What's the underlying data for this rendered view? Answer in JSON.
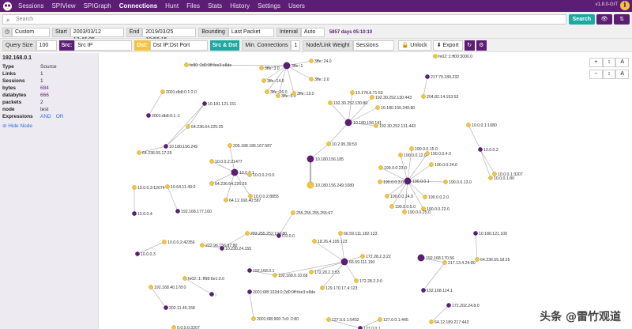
{
  "nav": {
    "items": [
      "Sessions",
      "SPIView",
      "SPIGraph",
      "Connections",
      "Hunt",
      "Files",
      "Stats",
      "History",
      "Settings",
      "Users"
    ],
    "active": "Connections",
    "version": "v1.8.0-GIT"
  },
  "search": {
    "placeholder": "Search",
    "button": "Search"
  },
  "time": {
    "range": "Custom",
    "start_label": "Start",
    "start_value": "2003/03/12 13:46:05",
    "end_label": "End",
    "end_value": "2019/03/25 18:56:15",
    "bounding_label": "Bounding",
    "bounding_value": "Last Packet",
    "interval_label": "Interval",
    "interval_value": "Auto",
    "days_text": "5857 days 05:10:10"
  },
  "options": {
    "query_size_label": "Query Size",
    "query_size_value": "100",
    "src_badge": "Src:",
    "src_value": "Src IP",
    "dst_badge": "Dst:",
    "dst_value": "Dst IP:Dst Port",
    "src_dst_button": "Src & Dst",
    "min_conn_label": "Min. Connections",
    "min_conn_value": "1",
    "weight_label": "Node/Link Weight",
    "weight_value": "Sessions",
    "unlock_button": "Unlock",
    "export_button": "Export"
  },
  "sidebar": {
    "title": "192.168.0.1",
    "rows": [
      {
        "key": "Type",
        "value": "Source"
      },
      {
        "key": "Links",
        "value": "1"
      },
      {
        "key": "Sessions",
        "value": "1"
      },
      {
        "key": "bytes",
        "value": "684"
      },
      {
        "key": "databytes",
        "value": "666"
      },
      {
        "key": "packets",
        "value": "2"
      },
      {
        "key": "node",
        "value": "test"
      }
    ],
    "expressions_label": "Expressions",
    "and_label": "AND",
    "or_label": "OR",
    "hide_node": "Hide Node"
  },
  "zoom": {
    "row1": [
      "+",
      "↕",
      "A"
    ],
    "row2": [
      "−",
      "↕",
      "A"
    ]
  },
  "colors": {
    "primary": "#5c1d74",
    "accent": "#f2c53a",
    "teal": "#1ba9a1"
  },
  "graph": {
    "nodes": [
      {
        "id": "n1",
        "label": "fe80::2d0:9ff:fee3:e8de",
        "type": "dst"
      },
      {
        "id": "n2",
        "label": "3ffe::1",
        "type": "src"
      },
      {
        "id": "n3",
        "label": "3ffe::3.0",
        "type": "dst"
      },
      {
        "id": "n4",
        "label": "3ffe::24.0",
        "type": "dst"
      },
      {
        "id": "n5",
        "label": "3ffe::14.0",
        "type": "dst"
      },
      {
        "id": "n6",
        "label": "3ffe::26.0",
        "type": "dst"
      },
      {
        "id": "n7",
        "label": "3ffe::5.0",
        "type": "dst"
      },
      {
        "id": "n8",
        "label": "3ffe::13.0",
        "type": "dst"
      },
      {
        "id": "n9",
        "label": "3ffe::2.0",
        "type": "dst"
      },
      {
        "id": "n10",
        "label": "fe02::1:ff00:3000.0",
        "type": "dst"
      },
      {
        "id": "n11",
        "label": "217.70.180.232",
        "type": "src"
      },
      {
        "id": "n12",
        "label": "204.82.14.153:53",
        "type": "dst"
      },
      {
        "id": "n13",
        "label": "2001:db8:0:1:2.0",
        "type": "dst"
      },
      {
        "id": "n14",
        "label": "2001:db8:0:1::1",
        "type": "src"
      },
      {
        "id": "n15",
        "label": "10.181.121.151",
        "type": "src"
      },
      {
        "id": "n16",
        "label": "64.236.64.225:25",
        "type": "dst"
      },
      {
        "id": "n17",
        "label": "10.178.8.71:53",
        "type": "dst"
      },
      {
        "id": "n18",
        "label": "192.30.252.130:443",
        "type": "dst"
      },
      {
        "id": "n19",
        "label": "192.30.252.130:80",
        "type": "dst"
      },
      {
        "id": "n20",
        "label": "10.180.156.249:80",
        "type": "dst"
      },
      {
        "id": "n21",
        "label": "10.180.156.141",
        "type": "src"
      },
      {
        "id": "n22",
        "label": "192.30.252.131:443",
        "type": "dst"
      },
      {
        "id": "n23",
        "label": "10.0.0.1:1080",
        "type": "dst"
      },
      {
        "id": "n24",
        "label": "10.180.156.249",
        "type": "src"
      },
      {
        "id": "n25",
        "label": "64.236.55.17:25",
        "type": "dst"
      },
      {
        "id": "n26",
        "label": "205.188.186.167:587",
        "type": "dst"
      },
      {
        "id": "n27",
        "label": "10.0.0.2:21477",
        "type": "dst"
      },
      {
        "id": "n28",
        "label": "10.2.95.39:53",
        "type": "dst"
      },
      {
        "id": "n29",
        "label": "10.180.156.185",
        "type": "src"
      },
      {
        "id": "n30",
        "label": "10.180.156.249:1080",
        "type": "dst"
      },
      {
        "id": "n31",
        "label": "10.0.0.1",
        "type": "src"
      },
      {
        "id": "n32",
        "label": "10.0.0.2:0.0",
        "type": "dst"
      },
      {
        "id": "n33",
        "label": "64.236.64.226:25",
        "type": "dst"
      },
      {
        "id": "n34",
        "label": "10.0.0.2:8855",
        "type": "dst"
      },
      {
        "id": "n35",
        "label": "64.12.168.40:587",
        "type": "dst"
      },
      {
        "id": "n36",
        "label": "10.0.0.3:12074",
        "type": "dst"
      },
      {
        "id": "n37",
        "label": "10.64.11.49:0",
        "type": "dst"
      },
      {
        "id": "n38",
        "label": "10.0.0.4",
        "type": "src"
      },
      {
        "id": "n39",
        "label": "192.168.177.160",
        "type": "src"
      },
      {
        "id": "n40",
        "label": "190.0.0.1",
        "type": "src"
      },
      {
        "id": "n41",
        "label": "190.0.0.15.0",
        "type": "dst"
      },
      {
        "id": "n42",
        "label": "190.0.0.12.0",
        "type": "dst"
      },
      {
        "id": "n43",
        "label": "190.0.0.4.0",
        "type": "dst"
      },
      {
        "id": "n44",
        "label": "190.0.0.23.0",
        "type": "dst"
      },
      {
        "id": "n45",
        "label": "190.0.0.24.0",
        "type": "dst"
      },
      {
        "id": "n46",
        "label": "190.0.0.3.0",
        "type": "dst"
      },
      {
        "id": "n47",
        "label": "190.0.0.13.0",
        "type": "dst"
      },
      {
        "id": "n48",
        "label": "190.0.0.14.0",
        "type": "dst"
      },
      {
        "id": "n49",
        "label": "190.0.0.5.0",
        "type": "dst"
      },
      {
        "id": "n50",
        "label": "190.0.0.2.0",
        "type": "dst"
      },
      {
        "id": "n51",
        "label": "190.0.0.22.0",
        "type": "dst"
      },
      {
        "id": "n52",
        "label": "190.0.0.25.0",
        "type": "dst"
      },
      {
        "id": "n53",
        "label": "10.0.0.2",
        "type": "src"
      },
      {
        "id": "n54",
        "label": "10.0.0.1:80",
        "type": "dst"
      },
      {
        "id": "n55",
        "label": "10.0.0.1:3207",
        "type": "dst"
      },
      {
        "id": "n56",
        "label": "255.255.255.255:67",
        "type": "dst"
      },
      {
        "id": "n57",
        "label": "10.0.0.2:42356",
        "type": "dst"
      },
      {
        "id": "n58",
        "label": "203.255.252.194:80",
        "type": "dst"
      },
      {
        "id": "n59",
        "label": "0.0.0.0",
        "type": "src"
      },
      {
        "id": "n60",
        "label": "10.0.0.3",
        "type": "src"
      },
      {
        "id": "n61",
        "label": "222.96.156.97:80",
        "type": "dst"
      },
      {
        "id": "n62",
        "label": "10.230.24.155",
        "type": "src"
      },
      {
        "id": "n63",
        "label": "18.26.4.105:123",
        "type": "dst"
      },
      {
        "id": "n64",
        "label": "66.59.111.182:123",
        "type": "dst"
      },
      {
        "id": "n65",
        "label": "10.180.121.109",
        "type": "src"
      },
      {
        "id": "n66",
        "label": "192.168.170.56",
        "type": "src"
      },
      {
        "id": "n67",
        "label": "217.13.4.24:80",
        "type": "dst"
      },
      {
        "id": "n68",
        "label": "64.236.55.18:25",
        "type": "dst"
      },
      {
        "id": "n69",
        "label": "66.59.111.190",
        "type": "src"
      },
      {
        "id": "n70",
        "label": "172.28.2.3:22",
        "type": "dst"
      },
      {
        "id": "n71",
        "label": "192.168.0.1",
        "type": "src"
      },
      {
        "id": "n72",
        "label": "192.168.0.10:68",
        "type": "dst"
      },
      {
        "id": "n73",
        "label": "172.28.2.3:53",
        "type": "dst"
      },
      {
        "id": "n74",
        "label": "172.28.2.3:0",
        "type": "dst"
      },
      {
        "id": "n75",
        "label": "fe02::1::ff98:6e1:0.0",
        "type": "dst"
      },
      {
        "id": "n76",
        "label": "192.168.40.178:0",
        "type": "dst"
      },
      {
        "id": "n77",
        "label": "::",
        "type": "src"
      },
      {
        "id": "n78",
        "label": "129.170.17.4:123",
        "type": "dst"
      },
      {
        "id": "n79",
        "label": "192.168.114.1",
        "type": "src"
      },
      {
        "id": "n80",
        "label": "202.11.40.158",
        "type": "src"
      },
      {
        "id": "n81",
        "label": "2001:6f8:102d:0:2d0:9ff:fee3:e8de",
        "type": "src"
      },
      {
        "id": "n82",
        "label": "172.202.24.8:0",
        "type": "src"
      },
      {
        "id": "n83",
        "label": "2001:6f8:900:7c0::2:80",
        "type": "dst"
      },
      {
        "id": "n84",
        "label": "127.0.0.1:5432",
        "type": "dst"
      },
      {
        "id": "n85",
        "label": "127.0.0.1:445",
        "type": "dst"
      },
      {
        "id": "n86",
        "label": "64.12.189.217:443",
        "type": "dst"
      },
      {
        "id": "n87",
        "label": "127.0.0.1",
        "type": "src"
      },
      {
        "id": "n88",
        "label": "0.0.0.0:3207",
        "type": "dst"
      }
    ]
  },
  "watermark": "头条 @雷竹观道"
}
